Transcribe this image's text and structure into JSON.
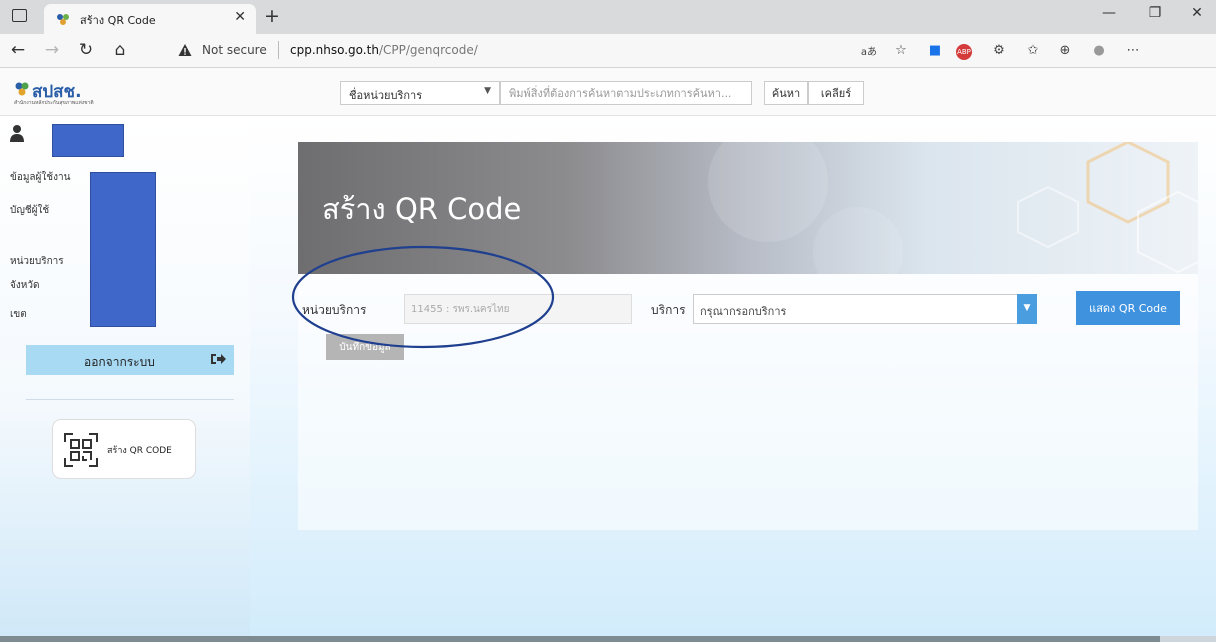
{
  "browser": {
    "tab_title": "สร้าง QR Code",
    "not_secure": "Not secure",
    "url_host": "cpp.nhso.go.th",
    "url_path": "/CPP/genqrcode/",
    "icons": {
      "tab_toggle": "tab-toggle-icon",
      "close": "close-icon",
      "new_tab": "plus-icon",
      "back": "arrow-left-icon",
      "forward": "arrow-right-icon",
      "refresh": "refresh-icon",
      "home": "home-icon",
      "warning": "warning-icon"
    },
    "extension_glyphs": {
      "read_aloud": "aあ",
      "favorites_add": "☆",
      "zoom": "■",
      "adblock": "ABP",
      "extensions": "⚙",
      "favorites": "✩",
      "collections": "⊕",
      "profile": "●",
      "more": "⋯"
    },
    "window_controls": {
      "minimize": "—",
      "maximize": "❐",
      "close": "✕"
    }
  },
  "header": {
    "logo_text": "สปสช.",
    "logo_sub": "สำนักงานหลักประกันสุขภาพแห่งชาติ",
    "search_type": "ชื่อหน่วยบริการ",
    "search_placeholder": "พิมพ์สิ่งที่ต้องการค้นหาตามประเภทการค้นหา...",
    "search_button": "ค้นหา",
    "clear_button": "เคลียร์"
  },
  "sidebar": {
    "user_info_label": "ข้อมูลผู้ใช้งาน",
    "account_label": "บัญชีผู้ใช้",
    "unit_label": "หน่วยบริการ",
    "province_label": "จังหวัด",
    "zone_label": "เขต",
    "logout_label": "ออกจากระบบ",
    "qr_menu_label": "สร้าง QR CODE"
  },
  "main": {
    "banner_title": "สร้าง QR Code",
    "unit_field_label": "หน่วยบริการ",
    "unit_field_value": "11455 : รพร.นครไทย",
    "service_label": "บริการ",
    "service_placeholder": "กรุณากรอกบริการ",
    "show_qr_button": "แสดง QR Code",
    "save_button": "บันทึกข้อมูล"
  },
  "colors": {
    "accent_blue": "#3f92de",
    "logout_bg": "#a9daf4",
    "redaction": "#3f67c9",
    "annotation": "#1f3f8f"
  }
}
